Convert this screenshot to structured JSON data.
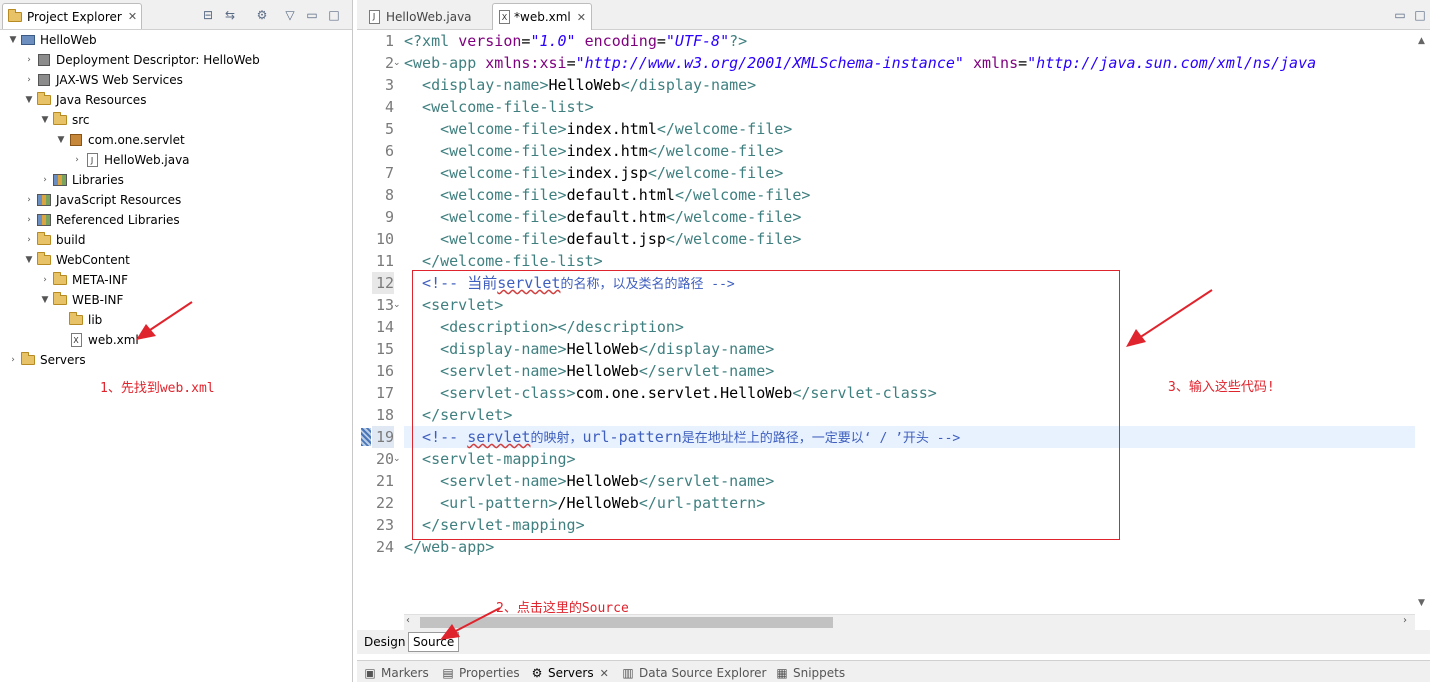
{
  "explorer": {
    "title": "Project Explorer",
    "close_glyph": "✕",
    "tree": [
      {
        "label": "HelloWeb",
        "icon": "project-icon",
        "expanded": true
      },
      {
        "label": "Deployment Descriptor: HelloWeb",
        "icon": "deployment-descriptor-icon",
        "expanded": false
      },
      {
        "label": "JAX-WS Web Services",
        "icon": "web-services-icon",
        "expanded": false
      },
      {
        "label": "Java Resources",
        "icon": "java-resources-icon",
        "expanded": true
      },
      {
        "label": "src",
        "icon": "source-folder-icon",
        "expanded": true
      },
      {
        "label": "com.one.servlet",
        "icon": "package-icon",
        "expanded": true
      },
      {
        "label": "HelloWeb.java",
        "icon": "java-file-icon",
        "expanded": false
      },
      {
        "label": "Libraries",
        "icon": "libraries-icon",
        "expanded": false
      },
      {
        "label": "JavaScript Resources",
        "icon": "javascript-resources-icon",
        "expanded": false
      },
      {
        "label": "Referenced Libraries",
        "icon": "referenced-libraries-icon",
        "expanded": false
      },
      {
        "label": "build",
        "icon": "folder-icon",
        "expanded": false
      },
      {
        "label": "WebContent",
        "icon": "folder-icon",
        "expanded": true
      },
      {
        "label": "META-INF",
        "icon": "folder-icon",
        "expanded": false
      },
      {
        "label": "WEB-INF",
        "icon": "folder-icon",
        "expanded": true
      },
      {
        "label": "lib",
        "icon": "folder-icon",
        "expanded": false
      },
      {
        "label": "web.xml",
        "icon": "xml-file-icon",
        "expanded": false
      },
      {
        "label": "Servers",
        "icon": "folder-icon",
        "expanded": false
      }
    ]
  },
  "editor": {
    "tabs": [
      {
        "label": "HelloWeb.java",
        "icon": "java-file-icon",
        "active": false
      },
      {
        "label": "*web.xml",
        "icon": "xml-file-icon",
        "active": true
      }
    ],
    "line_numbers": [
      "1",
      "2",
      "3",
      "4",
      "5",
      "6",
      "7",
      "8",
      "9",
      "10",
      "11",
      "12",
      "13",
      "14",
      "15",
      "16",
      "17",
      "18",
      "19",
      "20",
      "21",
      "22",
      "23",
      "24"
    ],
    "code": {
      "l1": {
        "a": "<?xml ",
        "b": "version",
        "c": "=",
        "d": "\"1.0\"",
        "e": " ",
        "f": "encoding",
        "g": "=",
        "h": "\"UTF-8\"",
        "i": "?>"
      },
      "l2": {
        "a": "<web-app ",
        "b": "xmlns:xsi",
        "c": "=",
        "d": "\"http://www.w3.org/2001/XMLSchema-instance\"",
        "e": " ",
        "f": "xmlns",
        "g": "=",
        "h": "\"http://java.sun.com/xml/ns/java"
      },
      "l3": {
        "a": "  <display-name>",
        "b": "HelloWeb",
        "c": "</display-name>"
      },
      "l4": {
        "a": "  <welcome-file-list>"
      },
      "l5": {
        "a": "    <welcome-file>",
        "b": "index.html",
        "c": "</welcome-file>"
      },
      "l6": {
        "a": "    <welcome-file>",
        "b": "index.htm",
        "c": "</welcome-file>"
      },
      "l7": {
        "a": "    <welcome-file>",
        "b": "index.jsp",
        "c": "</welcome-file>"
      },
      "l8": {
        "a": "    <welcome-file>",
        "b": "default.html",
        "c": "</welcome-file>"
      },
      "l9": {
        "a": "    <welcome-file>",
        "b": "default.htm",
        "c": "</welcome-file>"
      },
      "l10": {
        "a": "    <welcome-file>",
        "b": "default.jsp",
        "c": "</welcome-file>"
      },
      "l11": {
        "a": "  </welcome-file-list>"
      },
      "l12": {
        "a": "  <!-- 当前",
        "b": "servlet",
        "c": "的名称，以及类名的路径 -->"
      },
      "l13": {
        "a": "  <servlet>"
      },
      "l14": {
        "a": "    <description></description>"
      },
      "l15": {
        "a": "    <display-name>",
        "b": "HelloWeb",
        "c": "</display-name>"
      },
      "l16": {
        "a": "    <servlet-name>",
        "b": "HelloWeb",
        "c": "</servlet-name>"
      },
      "l17": {
        "a": "    <servlet-class>",
        "b": "com.one.servlet.HelloWeb",
        "c": "</servlet-class>"
      },
      "l18": {
        "a": "  </servlet>"
      },
      "l19": {
        "a": "  <!-- ",
        "b": "servlet",
        "c": "的映射，",
        "d": "url-pattern",
        "e": "是在地址栏上的路径，一定要以‘ / ’开头 -->"
      },
      "l20": {
        "a": "  <servlet-mapping>"
      },
      "l21": {
        "a": "    <servlet-name>",
        "b": "HelloWeb",
        "c": "</servlet-name>"
      },
      "l22": {
        "a": "    <url-pattern>",
        "b": "/HelloWeb",
        "c": "</url-pattern>"
      },
      "l23": {
        "a": "  </servlet-mapping>"
      },
      "l24": {
        "a": "</web-app>"
      }
    },
    "bottom_tabs": {
      "design": "Design",
      "source": "Source",
      "active": "Source"
    }
  },
  "views": [
    {
      "label": "Markers",
      "icon": "markers-icon"
    },
    {
      "label": "Properties",
      "icon": "properties-icon"
    },
    {
      "label": "Servers",
      "icon": "servers-icon",
      "active": true,
      "close_glyph": "✕"
    },
    {
      "label": "Data Source Explorer",
      "icon": "data-source-icon"
    },
    {
      "label": "Snippets",
      "icon": "snippets-icon"
    }
  ],
  "annotations": {
    "step1": "1、先找到web.xml",
    "step2": "2、点击这里的Source",
    "step3": "3、输入这些代码!",
    "color": "#e0242d"
  },
  "colors": {
    "tag": "#3f7f7f",
    "attribute": "#7f007f",
    "value": "#2a00ff",
    "comment": "#3f5fbf",
    "current_line": "#e8f2fe"
  }
}
